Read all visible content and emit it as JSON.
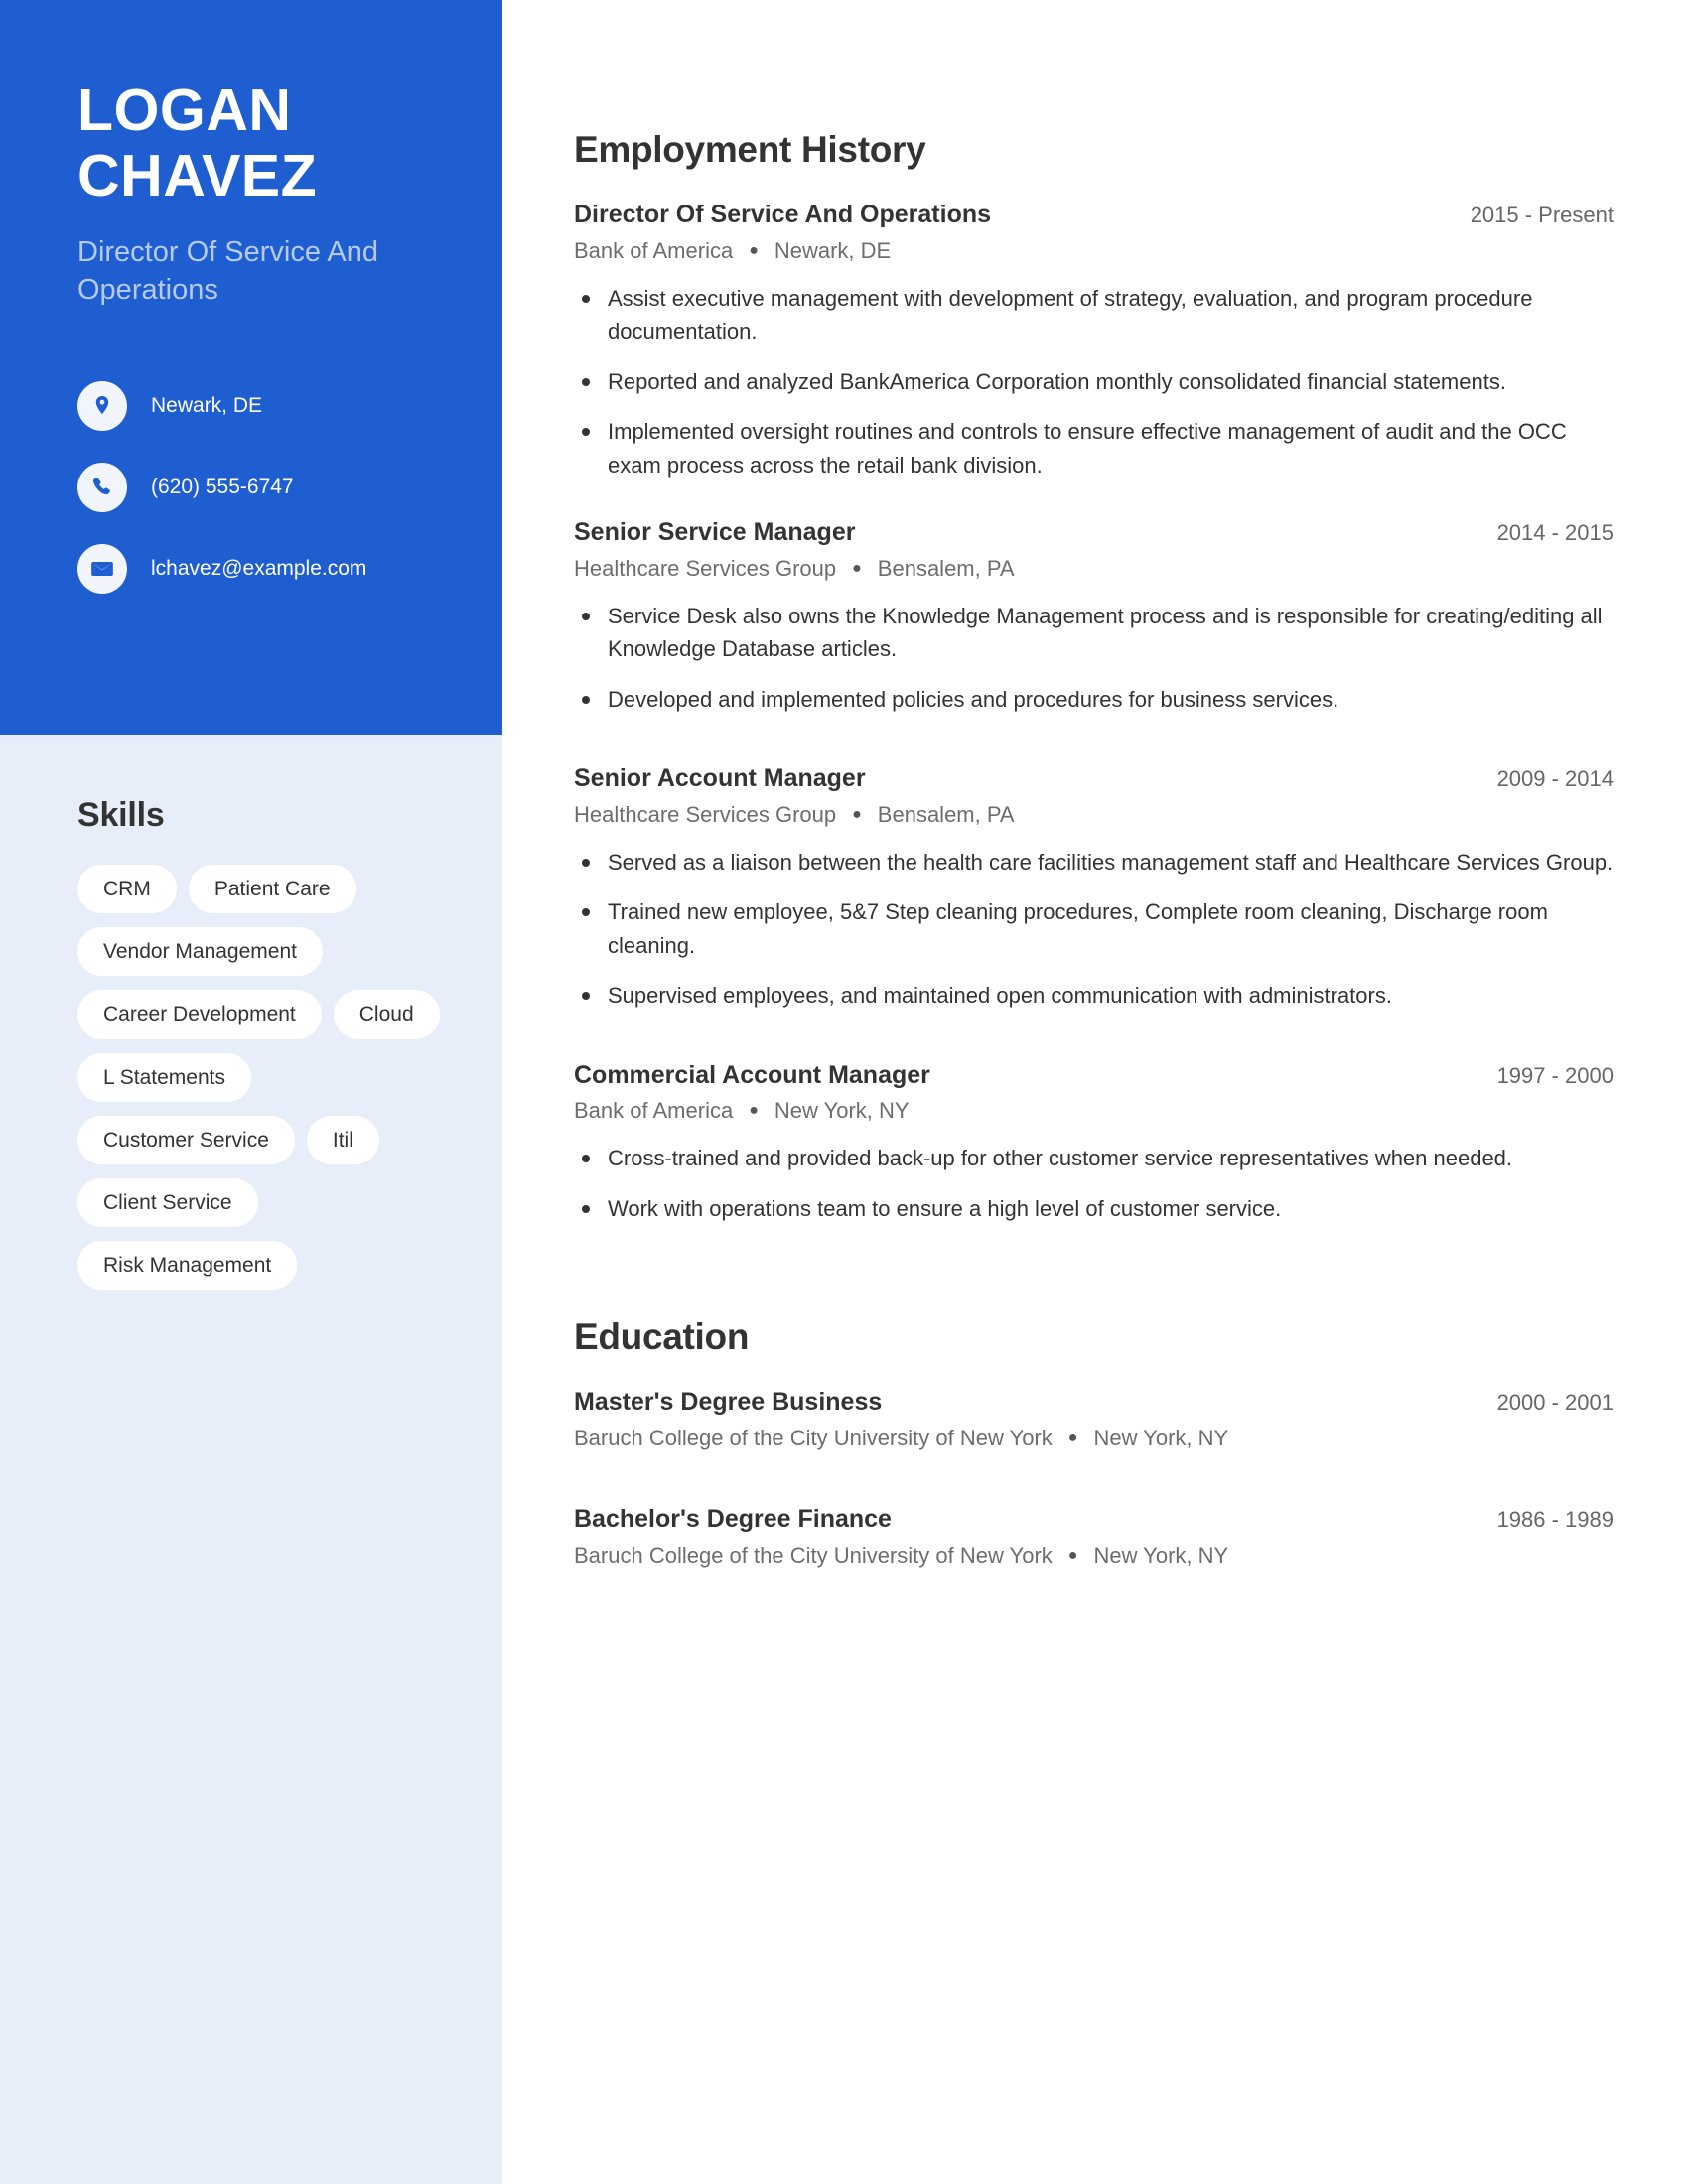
{
  "theme": {
    "accent_blue": "#1f5ed0",
    "sidebar_bg": "#e8eef9",
    "subtitle_blue": "#b5caec",
    "text_dark": "#333333",
    "text_muted": "#6d6d6d"
  },
  "profile": {
    "first_name": "LOGAN",
    "last_name": "CHAVEZ",
    "job_title": "Director Of Service And Operations"
  },
  "contact": {
    "items": [
      {
        "icon": "location-pin-icon",
        "text": "Newark, DE"
      },
      {
        "icon": "phone-icon",
        "text": "(620) 555-6747"
      },
      {
        "icon": "email-icon",
        "text": "lchavez@example.com"
      }
    ]
  },
  "skills": {
    "heading": "Skills",
    "tags": [
      "CRM",
      "Patient Care",
      "Vendor Management",
      "Career Development",
      "Cloud",
      "L Statements",
      "Customer Service",
      "Itil",
      "Client Service",
      "Risk Management"
    ]
  },
  "employment": {
    "heading": "Employment History",
    "entries": [
      {
        "title": "Director Of Service And Operations",
        "date": "2015 - Present",
        "company": "Bank of America",
        "location": "Newark, DE",
        "bullets": [
          "Assist executive management with development of strategy, evaluation, and program procedure documentation.",
          "Reported and analyzed BankAmerica Corporation monthly consolidated financial statements.",
          "Implemented oversight routines and controls to ensure effective management of audit and the OCC exam process across the retail bank division."
        ]
      },
      {
        "title": "Senior Service Manager",
        "date": "2014 - 2015",
        "company": "Healthcare Services Group",
        "location": "Bensalem, PA",
        "bullets": [
          "Service Desk also owns the Knowledge Management process and is responsible for creating/editing all Knowledge Database articles.",
          "Developed and implemented policies and procedures for business services."
        ]
      },
      {
        "title": "Senior Account Manager",
        "date": "2009 - 2014",
        "company": "Healthcare Services Group",
        "location": "Bensalem, PA",
        "bullets": [
          "Served as a liaison between the health care facilities management staff and Healthcare Services Group.",
          "Trained new employee, 5&7 Step cleaning procedures, Complete room cleaning, Discharge room cleaning.",
          "Supervised employees, and maintained open communication with administrators."
        ]
      },
      {
        "title": "Commercial Account Manager",
        "date": "1997 - 2000",
        "company": "Bank of America",
        "location": "New York, NY",
        "bullets": [
          "Cross-trained and provided back-up for other customer service representatives when needed.",
          "Work with operations team to ensure a high level of customer service."
        ]
      }
    ]
  },
  "education": {
    "heading": "Education",
    "entries": [
      {
        "title": "Master's Degree Business",
        "date": "2000 - 2001",
        "school": "Baruch College of the City University of New York",
        "location": "New York, NY"
      },
      {
        "title": "Bachelor's Degree Finance",
        "date": "1986 - 1989",
        "school": "Baruch College of the City University of New York",
        "location": "New York, NY"
      }
    ]
  }
}
